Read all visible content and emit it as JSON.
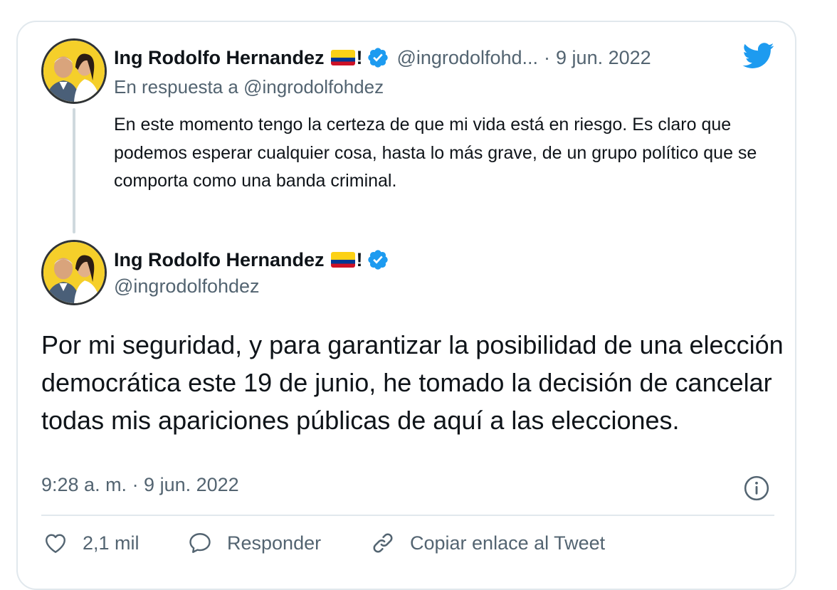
{
  "reply_tweet": {
    "author_name": "Ing Rodolfo Hernandez",
    "name_suffix": "!",
    "handle_truncated": "@ingrodolfohd...",
    "separator": "·",
    "date": "9 jun. 2022",
    "in_reply_to": "En respuesta a @ingrodolfohdez",
    "text": "En este momento tengo la certeza de que mi vida está en riesgo. Es claro que podemos esperar cualquier cosa, hasta lo más grave, de un grupo político que se comporta como una banda criminal."
  },
  "main_tweet": {
    "author_name": "Ing Rodolfo Hernandez",
    "name_suffix": "!",
    "handle": "@ingrodolfohdez",
    "text": "Por mi seguridad, y para garantizar la posibilidad de una elección democrática este 19 de junio, he tomado la decisión de cancelar todas mis apariciones públicas de aquí a las elecciones.",
    "timestamp": "9:28 a. m. · 9 jun. 2022"
  },
  "actions": {
    "like_count": "2,1 mil",
    "reply_label": "Responder",
    "copy_link_label": "Copiar enlace al Tweet"
  },
  "icons": {
    "brand": "twitter-bird-icon",
    "verified": "verified-badge-icon",
    "flag": "colombia-flag-icon",
    "info": "info-icon",
    "like": "heart-icon",
    "reply": "speech-bubble-icon",
    "link": "link-icon"
  },
  "colors": {
    "twitter_blue": "#1d9bf0",
    "text_primary": "#0f1419",
    "text_secondary": "#536471",
    "border": "#e1e8ed"
  }
}
